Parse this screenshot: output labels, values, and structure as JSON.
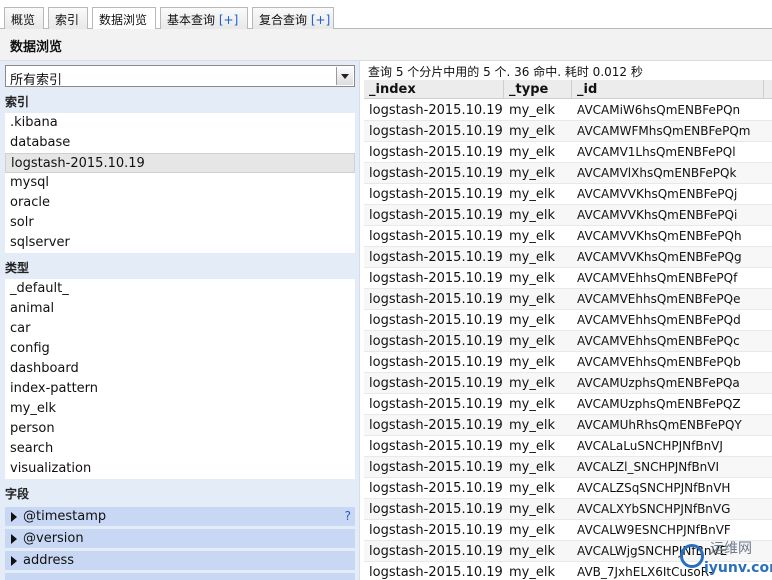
{
  "tabs": [
    {
      "label": "概览",
      "plus": ""
    },
    {
      "label": "索引",
      "plus": ""
    },
    {
      "label": "数据浏览",
      "plus": ""
    },
    {
      "label": "基本查询 ",
      "plus": "[+]"
    },
    {
      "label": "复合查询 ",
      "plus": "[+]"
    }
  ],
  "page_title": "数据浏览",
  "index_select": {
    "value": "所有索引"
  },
  "sections": {
    "indices": "索引",
    "types": "类型",
    "fields": "字段"
  },
  "indices": [
    ".kibana",
    "database",
    "logstash-2015.10.19",
    "mysql",
    "oracle",
    "solr",
    "sqlserver"
  ],
  "types": [
    "_default_",
    "animal",
    "car",
    "config",
    "dashboard",
    "index-pattern",
    "my_elk",
    "person",
    "search",
    "visualization"
  ],
  "fields": [
    {
      "label": "@timestamp",
      "help": "?"
    },
    {
      "label": "@version",
      "help": ""
    },
    {
      "label": "address",
      "help": ""
    }
  ],
  "summary": "查询 5 个分片中用的 5 个. 36 命中. 耗时 0.012 秒",
  "columns": [
    "_index",
    "_type",
    "_id"
  ],
  "rows": [
    [
      "logstash-2015.10.19",
      "my_elk",
      "AVCAMiW6hsQmENBFePQn"
    ],
    [
      "logstash-2015.10.19",
      "my_elk",
      "AVCAMWFMhsQmENBFePQm"
    ],
    [
      "logstash-2015.10.19",
      "my_elk",
      "AVCAMV1LhsQmENBFePQl"
    ],
    [
      "logstash-2015.10.19",
      "my_elk",
      "AVCAMVlXhsQmENBFePQk"
    ],
    [
      "logstash-2015.10.19",
      "my_elk",
      "AVCAMVVKhsQmENBFePQj"
    ],
    [
      "logstash-2015.10.19",
      "my_elk",
      "AVCAMVVKhsQmENBFePQi"
    ],
    [
      "logstash-2015.10.19",
      "my_elk",
      "AVCAMVVKhsQmENBFePQh"
    ],
    [
      "logstash-2015.10.19",
      "my_elk",
      "AVCAMVVKhsQmENBFePQg"
    ],
    [
      "logstash-2015.10.19",
      "my_elk",
      "AVCAMVEhhsQmENBFePQf"
    ],
    [
      "logstash-2015.10.19",
      "my_elk",
      "AVCAMVEhhsQmENBFePQe"
    ],
    [
      "logstash-2015.10.19",
      "my_elk",
      "AVCAMVEhhsQmENBFePQd"
    ],
    [
      "logstash-2015.10.19",
      "my_elk",
      "AVCAMVEhhsQmENBFePQc"
    ],
    [
      "logstash-2015.10.19",
      "my_elk",
      "AVCAMVEhhsQmENBFePQb"
    ],
    [
      "logstash-2015.10.19",
      "my_elk",
      "AVCAMUzphsQmENBFePQa"
    ],
    [
      "logstash-2015.10.19",
      "my_elk",
      "AVCAMUzphsQmENBFePQZ"
    ],
    [
      "logstash-2015.10.19",
      "my_elk",
      "AVCAMUhRhsQmENBFePQY"
    ],
    [
      "logstash-2015.10.19",
      "my_elk",
      "AVCALaLuSNCHPJNfBnVJ"
    ],
    [
      "logstash-2015.10.19",
      "my_elk",
      "AVCALZl_SNCHPJNfBnVI"
    ],
    [
      "logstash-2015.10.19",
      "my_elk",
      "AVCALZSqSNCHPJNfBnVH"
    ],
    [
      "logstash-2015.10.19",
      "my_elk",
      "AVCALXYbSNCHPJNfBnVG"
    ],
    [
      "logstash-2015.10.19",
      "my_elk",
      "AVCALW9ESNCHPJNfBnVF"
    ],
    [
      "logstash-2015.10.19",
      "my_elk",
      "AVCALWjgSNCHPJNfBnVE"
    ],
    [
      "logstash-2015.10.19",
      "my_elk",
      "AVB_7JxhELX6ItCusoR-"
    ]
  ],
  "watermark": {
    "line1": "运维网",
    "line2": "iyunv.com"
  }
}
